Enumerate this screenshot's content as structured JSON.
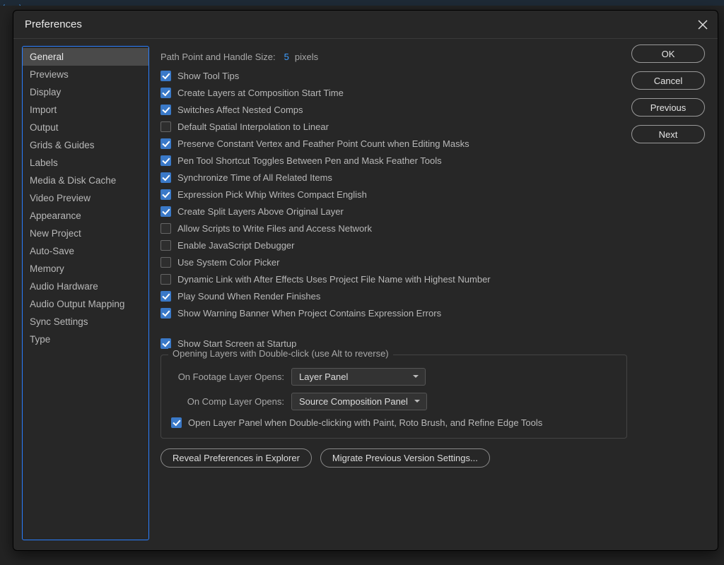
{
  "window": {
    "title": "Preferences"
  },
  "sidebar": {
    "items": [
      "General",
      "Previews",
      "Display",
      "Import",
      "Output",
      "Grids & Guides",
      "Labels",
      "Media & Disk Cache",
      "Video Preview",
      "Appearance",
      "New Project",
      "Auto-Save",
      "Memory",
      "Audio Hardware",
      "Audio Output Mapping",
      "Sync Settings",
      "Type"
    ],
    "selected": 0
  },
  "actions": {
    "ok": "OK",
    "cancel": "Cancel",
    "previous": "Previous",
    "next": "Next"
  },
  "path_size": {
    "label": "Path Point and Handle Size:",
    "value": "5",
    "unit": "pixels"
  },
  "checks1": [
    {
      "label": "Show Tool Tips",
      "checked": true
    },
    {
      "label": "Create Layers at Composition Start Time",
      "checked": true
    },
    {
      "label": "Switches Affect Nested Comps",
      "checked": true
    },
    {
      "label": "Default Spatial Interpolation to Linear",
      "checked": false
    },
    {
      "label": "Preserve Constant Vertex and Feather Point Count when Editing Masks",
      "checked": true
    },
    {
      "label": "Pen Tool Shortcut Toggles Between Pen and Mask Feather Tools",
      "checked": true
    },
    {
      "label": "Synchronize Time of All Related Items",
      "checked": true
    },
    {
      "label": "Expression Pick Whip Writes Compact English",
      "checked": true
    },
    {
      "label": "Create Split Layers Above Original Layer",
      "checked": true
    },
    {
      "label": "Allow Scripts to Write Files and Access Network",
      "checked": false
    },
    {
      "label": "Enable JavaScript Debugger",
      "checked": false
    },
    {
      "label": "Use System Color Picker",
      "checked": false
    },
    {
      "label": "Dynamic Link with After Effects Uses Project File Name with Highest Number",
      "checked": false
    },
    {
      "label": "Play Sound When Render Finishes",
      "checked": true
    },
    {
      "label": "Show Warning Banner When Project Contains Expression Errors",
      "checked": true
    }
  ],
  "start_screen": {
    "label": "Show Start Screen at Startup",
    "checked": true
  },
  "dblclick_group": {
    "title": "Opening Layers with Double-click (use Alt to reverse)",
    "footage_label": "On Footage Layer Opens:",
    "footage_value": "Layer Panel",
    "comp_label": "On Comp Layer Opens:",
    "comp_value": "Source Composition Panel",
    "open_panel": {
      "label": "Open Layer Panel when Double-clicking with Paint, Roto Brush, and Refine Edge Tools",
      "checked": true
    }
  },
  "bottom_buttons": {
    "reveal": "Reveal Preferences in Explorer",
    "migrate": "Migrate Previous Version Settings..."
  }
}
